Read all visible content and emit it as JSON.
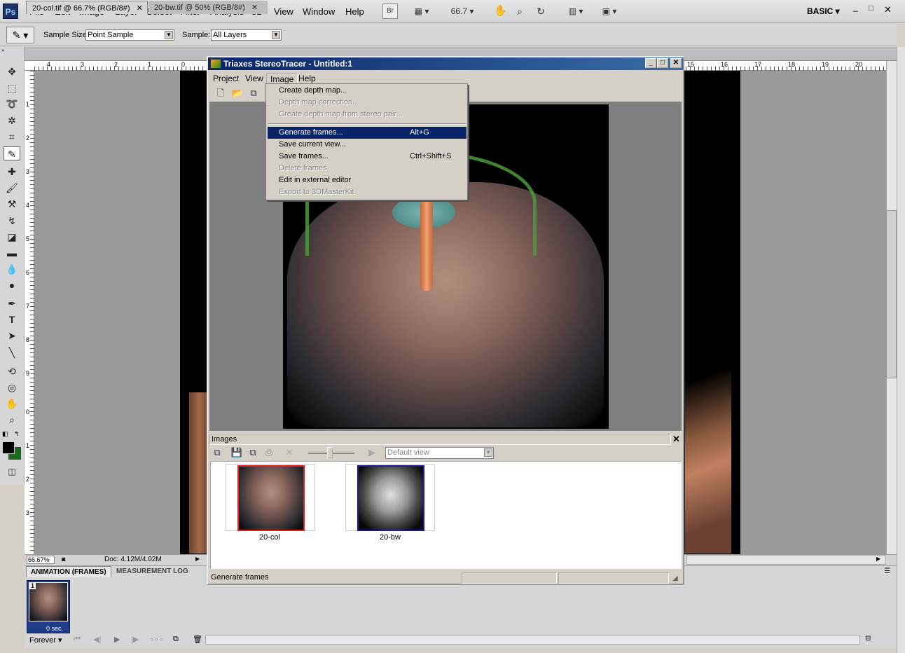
{
  "app": {
    "logo": "Ps",
    "workspace": "BASIC",
    "zoom": "66.7"
  },
  "menu": [
    "File",
    "Edit",
    "Image",
    "Layer",
    "Select",
    "Filter",
    "Analysis",
    "3D",
    "View",
    "Window",
    "Help"
  ],
  "toolbar": {
    "br_label": "Br"
  },
  "options": {
    "sample_size_label": "Sample Size:",
    "sample_size_value": "Point Sample",
    "sample_label": "Sample:",
    "sample_value": "All Layers"
  },
  "doc_tabs": [
    {
      "label": "20-col.tif @ 66.7% (RGB/8#)"
    },
    {
      "label": "20-bw.tif @ 50% (RGB/8#)"
    }
  ],
  "ruler_top": [
    "4",
    "3",
    "2",
    "1",
    "0",
    "15",
    "16",
    "17",
    "18",
    "19",
    "20"
  ],
  "ruler_left": [
    "1",
    "2",
    "3",
    "4",
    "5",
    "6",
    "7",
    "8",
    "9",
    "0",
    "1",
    "2",
    "3"
  ],
  "status": {
    "zoom": "66.67%",
    "doc": "Doc: 4.12M/4.02M"
  },
  "panel": {
    "tab_active": "ANIMATION (FRAMES)",
    "tab_other": "MEASUREMENT LOG",
    "frame_number": "1",
    "frame_delay": "0 sec.",
    "loop": "Forever"
  },
  "dialog": {
    "title": "Triaxes StereoTracer - Untitled:1",
    "menu": [
      "Project",
      "View",
      "Image",
      "Help"
    ],
    "image_menu": [
      {
        "label": "Create depth map...",
        "shortcut": "",
        "state": "enabled"
      },
      {
        "label": "Depth map correction...",
        "shortcut": "",
        "state": "disabled"
      },
      {
        "label": "Create depth map from stereo pair...",
        "shortcut": "",
        "state": "disabled"
      },
      {
        "label": "Generate frames...",
        "shortcut": "Alt+G",
        "state": "selected"
      },
      {
        "label": "Save current view...",
        "shortcut": "",
        "state": "enabled"
      },
      {
        "label": "Save frames...",
        "shortcut": "Ctrl+Shift+S",
        "state": "enabled"
      },
      {
        "label": "Delete frames",
        "shortcut": "",
        "state": "disabled"
      },
      {
        "label": "Edit in external editor",
        "shortcut": "",
        "state": "enabled"
      },
      {
        "label": "Export to 3DMasterKit",
        "shortcut": "",
        "state": "disabled"
      }
    ],
    "images_panel_title": "Images",
    "view_select": "Default view",
    "thumbs": [
      {
        "label": "20-col",
        "border": "#e02020"
      },
      {
        "label": "20-bw",
        "border": "#1a1a9a"
      }
    ],
    "status_text": "Generate frames"
  }
}
